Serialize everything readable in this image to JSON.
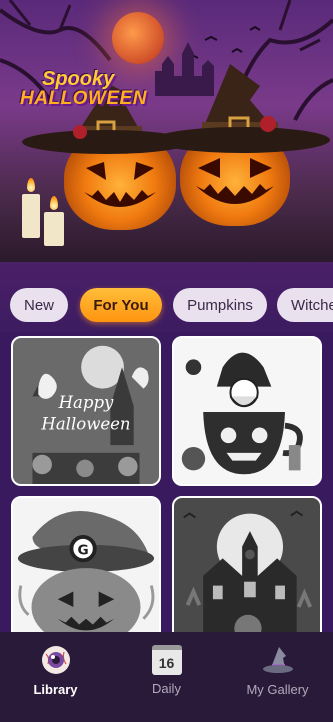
{
  "hero": {
    "logo_line1": "Spooky",
    "logo_line2": "HALLOWEEN"
  },
  "categories": [
    {
      "label": "New",
      "active": false
    },
    {
      "label": "For You",
      "active": true
    },
    {
      "label": "Pumpkins",
      "active": false
    },
    {
      "label": "Witches",
      "active": false
    }
  ],
  "cards": [
    {
      "title": "Happy",
      "subtitle": "Halloween",
      "scene": "haunted-greeting"
    },
    {
      "title": "",
      "subtitle": "",
      "scene": "gnome-cup"
    },
    {
      "title": "",
      "subtitle": "",
      "scene": "witch-hat-pumpkin"
    },
    {
      "title": "",
      "subtitle": "",
      "scene": "haunted-house"
    }
  ],
  "nav": {
    "items": [
      {
        "label": "Library",
        "icon": "eyeball-icon",
        "active": true
      },
      {
        "label": "Daily",
        "icon": "calendar-icon",
        "active": false,
        "day": "16"
      },
      {
        "label": "My Gallery",
        "icon": "witch-hat-icon",
        "active": false
      }
    ]
  },
  "colors": {
    "accent": "#ff9e1a",
    "background": "#3a1a5e",
    "nav_bg": "#2a1a3a"
  }
}
